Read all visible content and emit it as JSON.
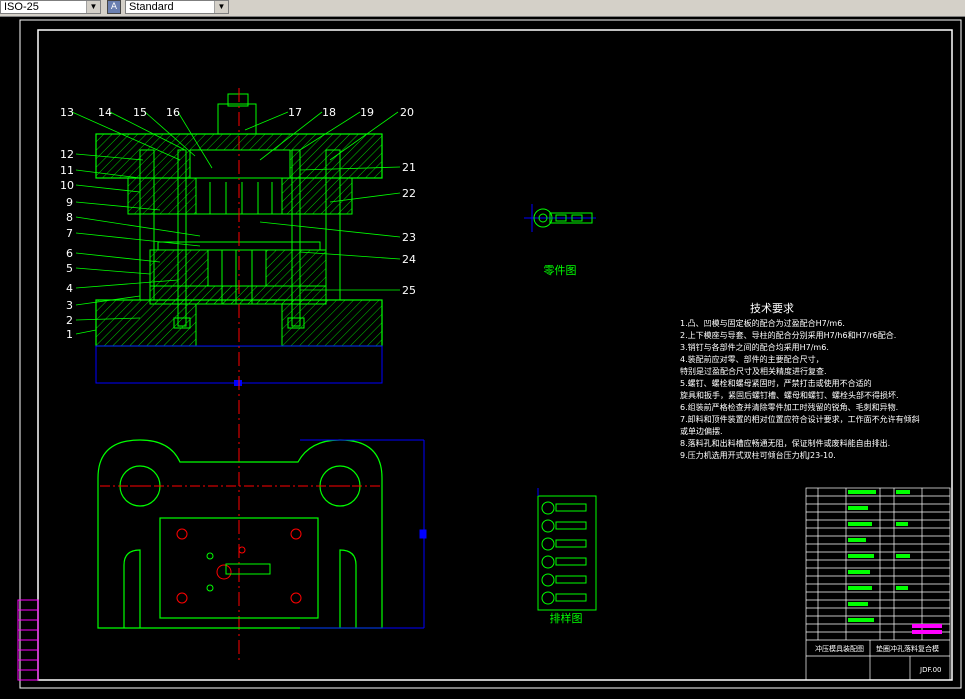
{
  "toolbar": {
    "dimstyle_value": "ISO-25",
    "textstyle_value": "Standard"
  },
  "drawing": {
    "leader_numbers_left": [
      "13",
      "14",
      "15",
      "16",
      "12",
      "11",
      "10",
      "9",
      "8",
      "7",
      "6",
      "5",
      "4",
      "3",
      "2",
      "1"
    ],
    "leader_numbers_top_right": [
      "17",
      "18",
      "19",
      "20"
    ],
    "leader_numbers_right": [
      "21",
      "22",
      "23",
      "24",
      "25"
    ],
    "part_label": "零件图",
    "strip_label": "排样图",
    "tech_title": "技术要求",
    "tech_lines": [
      "1.凸、凹模与固定板的配合为过盈配合H7/m6.",
      "2.上下模座与导套、导柱的配合分别采用H7/h6和H7/r6配合.",
      "3.销钉与各部件之间的配合均采用H7/m6.",
      "4.装配前应对零、部件的主要配合尺寸，",
      "  特别是过盈配合尺寸及相关精度进行复查.",
      "5.螺钉、螺栓和螺母紧固时，严禁打击或使用不合适的",
      "  旋具和扳手，紧固后螺钉槽、螺母和螺钉、螺栓头部不得损坏.",
      "6.组装前严格检查并清除零件加工时残留的锐角、毛刺和异物.",
      "7.卸料和顶件装置的相对位置应符合设计要求，工作面不允许有倾斜",
      "  或单边偏摆.",
      "8.落料孔和出料槽应畅通无阻，保证制件或废料能自由排出.",
      "9.压力机选用开式双柱可倾台压力机J23-10."
    ],
    "title_block_name": "冲压模具装配图",
    "title_block_part": "垫圈冲孔落料复合模",
    "title_block_code": "JDF.00"
  },
  "colors": {
    "background": "#000000",
    "outline": "#ffffff",
    "geometry": "#00ff00",
    "leaders": "#00ff00",
    "dimension": "#0000ff",
    "centerline": "#ff0000",
    "hatch": "#00ff00",
    "accent": "#ff00ff"
  }
}
